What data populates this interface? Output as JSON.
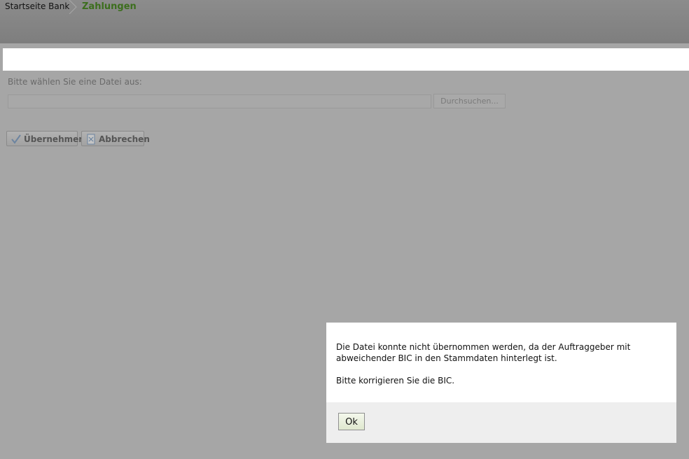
{
  "breadcrumb": {
    "home": "Startseite Bank",
    "current": "Zahlungen"
  },
  "upload": {
    "label": "Bitte wählen Sie eine Datei aus:",
    "value": "",
    "browse_label": "Durchsuchen..."
  },
  "actions": {
    "apply_label": "Übernehmen",
    "cancel_label": "Abbrechen"
  },
  "dialog": {
    "message_line1": "Die Datei konnte nicht übernommen werden, da der Auftraggeber mit abweichender BIC in den Stammdaten hinterlegt ist.",
    "message_line2": "Bitte korrigieren Sie die BIC.",
    "ok_label": "Ok"
  },
  "colors": {
    "accent": "#3c6e1d",
    "overlay": "#a6a6a6"
  }
}
